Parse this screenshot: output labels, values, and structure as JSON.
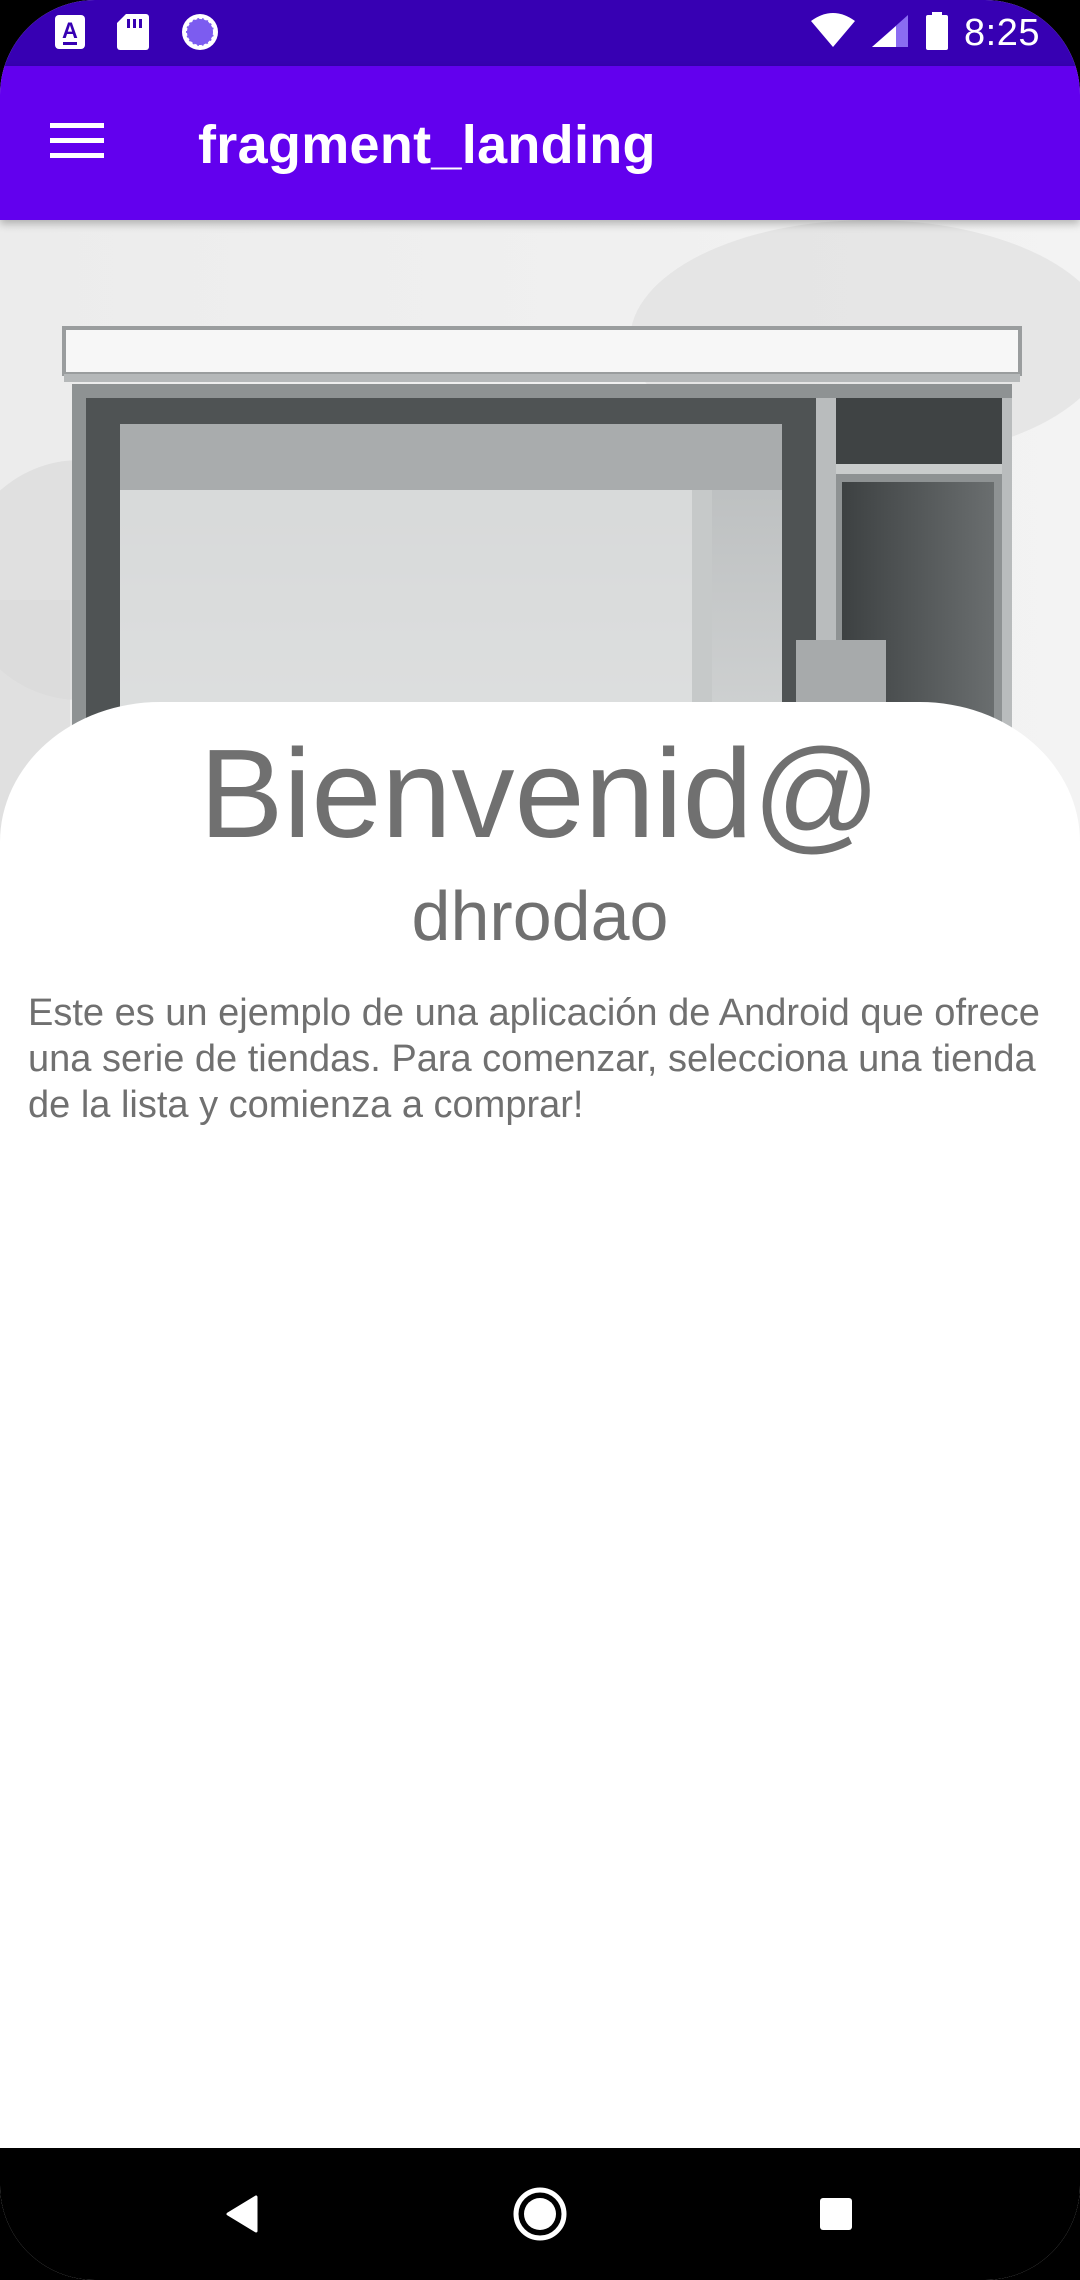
{
  "status_bar": {
    "time": "8:25",
    "left_icons": [
      "a-notification-icon",
      "sd-card-icon",
      "sync-icon"
    ],
    "right_icons": [
      "wifi-icon",
      "signal-icon",
      "battery-icon"
    ]
  },
  "app_bar": {
    "title": "fragment_landing",
    "menu_icon": "hamburger-menu-icon"
  },
  "hero": {
    "image": "storefront-photo"
  },
  "content": {
    "welcome_title": "Bienvenid@",
    "username": "dhrodao",
    "description": "Este es un ejemplo de una aplicación de Android que ofrece una serie de tiendas. Para comenzar, selecciona una tienda de la lista y comienza a comprar!"
  },
  "nav_bar": {
    "buttons": [
      "back-icon",
      "home-icon",
      "recents-icon"
    ]
  },
  "colors": {
    "status_bar": "#3700b3",
    "app_bar": "#6200ee",
    "text_gray": "#707070",
    "nav_bar": "#000000"
  }
}
